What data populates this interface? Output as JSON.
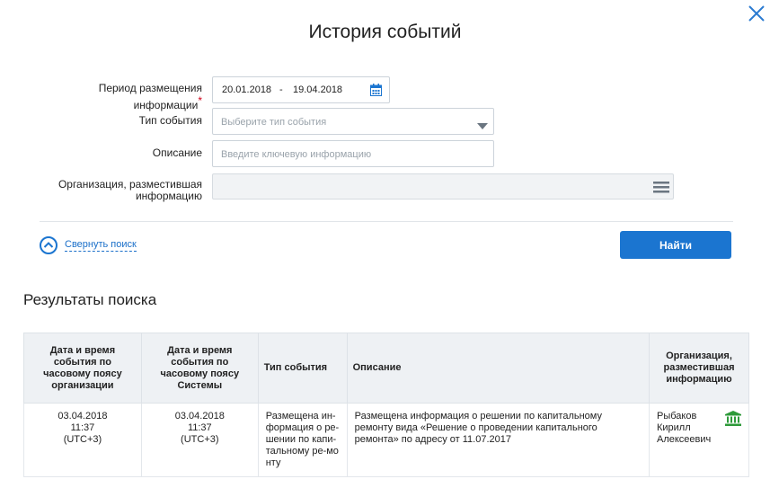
{
  "dialog": {
    "title": "История событий",
    "close_icon": "close-icon"
  },
  "form": {
    "period": {
      "label": "Период размещения информации",
      "required_mark": "*",
      "from": "20.01.2018",
      "separator": "-",
      "to": "19.04.2018",
      "icon": "calendar-icon"
    },
    "event_type": {
      "label": "Тип события",
      "placeholder": "Выберите тип события",
      "icon": "chevron-down-icon"
    },
    "description": {
      "label": "Описание",
      "placeholder": "Введите ключевую информацию"
    },
    "organization": {
      "label_line1": "Организация, разместившая",
      "label_line2": "информацию",
      "icon": "menu-icon"
    },
    "collapse_label": "Свернуть поиск",
    "find_button": "Найти"
  },
  "results": {
    "title": "Результаты поиска",
    "columns": [
      "Дата и время события по часовому поясу организации",
      "Дата и время события по часовому поясу Системы",
      "Тип события",
      "Описание",
      "Организация, разместившая информацию"
    ],
    "rows": [
      {
        "org_date": "03.04.2018",
        "org_time": "11:37",
        "org_tz": "(UTC+3)",
        "sys_date": "03.04.2018",
        "sys_time": "11:37",
        "sys_tz": "(UTC+3)",
        "type": "Размещена ин-формация о ре-шении по капи-тальному ре-монту",
        "description": "Размещена информация о решении по капитальному ремонту вида «Решение о проведении капитального ремонта» по адресу от 11.07.2017",
        "organization": "Рыбаков Кирилл Алексеевич",
        "org_icon": "government-building-icon"
      }
    ]
  },
  "colors": {
    "accent": "#1b75d0",
    "link": "#1a6fc9",
    "required": "#d0021b",
    "org_icon": "#2e9a3a"
  }
}
